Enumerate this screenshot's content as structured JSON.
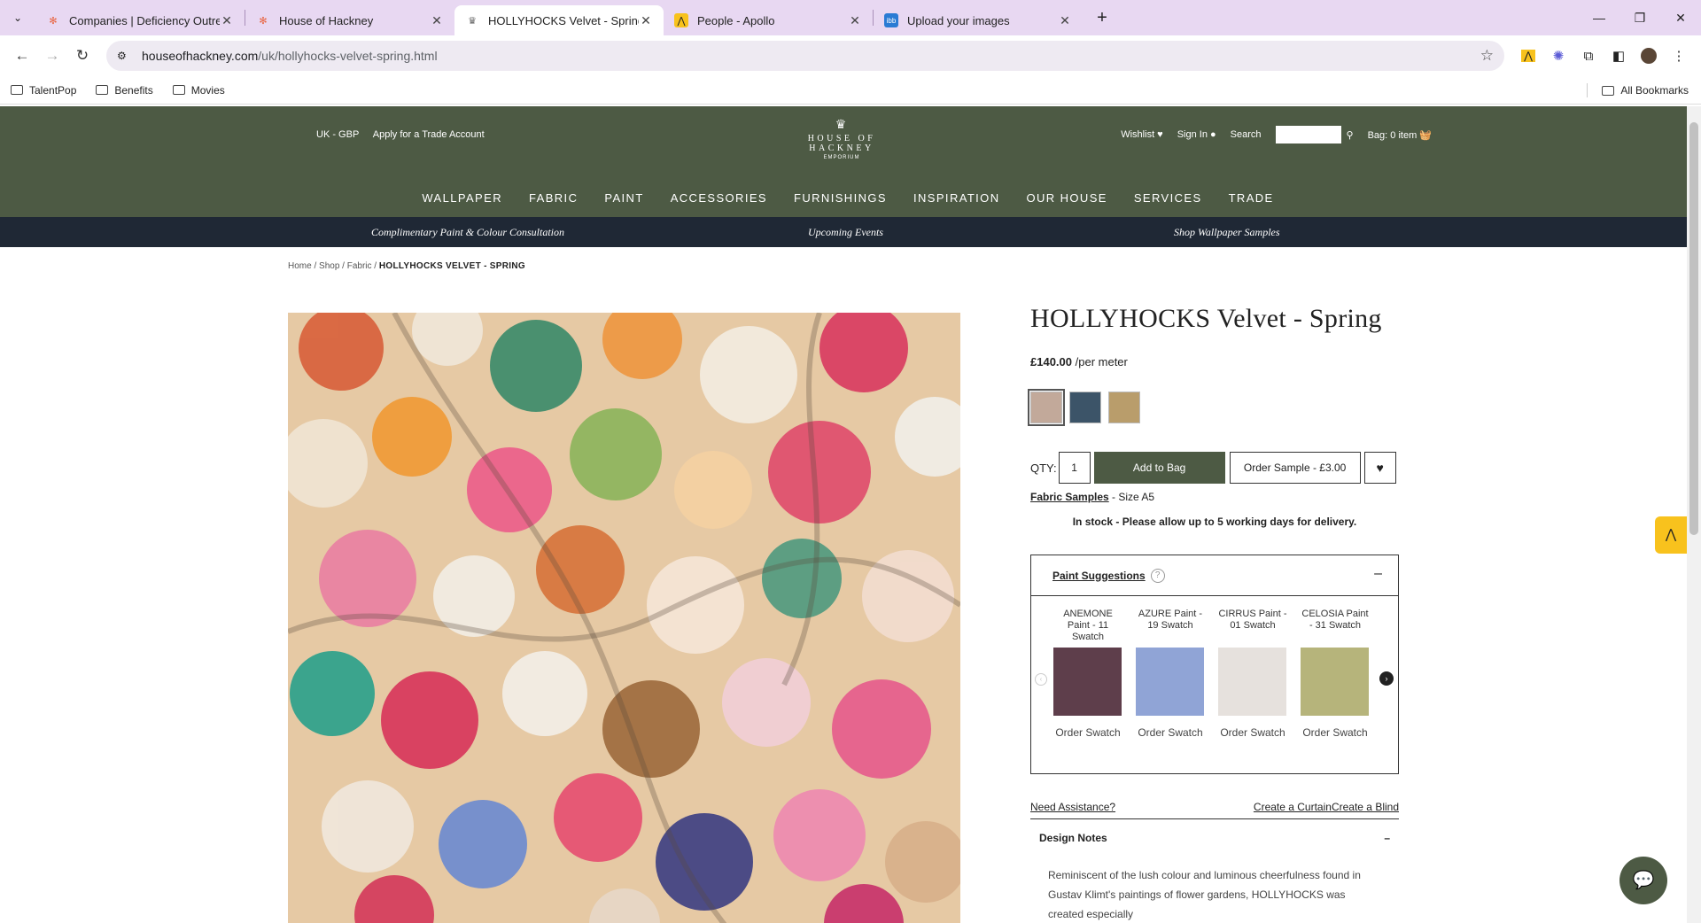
{
  "browser": {
    "tabs": [
      {
        "title": "Companies | Deficiency Outreach",
        "icon": "hubspot-icon"
      },
      {
        "title": "House of Hackney",
        "icon": "hubspot-icon"
      },
      {
        "title": "HOLLYHOCKS Velvet - Spring | House",
        "icon": "crown-icon"
      },
      {
        "title": "People - Apollo",
        "icon": "apollo-icon"
      },
      {
        "title": "Upload your images",
        "icon": "imgbb-icon"
      }
    ],
    "url_domain": "houseofhackney.com",
    "url_path": "/uk/hollyhocks-velvet-spring.html",
    "bookmarks": [
      "TalentPop",
      "Benefits",
      "Movies"
    ],
    "all_bookmarks": "All Bookmarks"
  },
  "header": {
    "region": "UK - GBP",
    "trade_account": "Apply for a Trade Account",
    "logo_name": "HOUSE OF HACKNEY",
    "logo_sub": "EMPORIUM",
    "wishlist": "Wishlist ♥",
    "signin": "Sign In ●",
    "search": "Search",
    "bag": "Bag: 0 item",
    "nav": [
      "WALLPAPER",
      "FABRIC",
      "PAINT",
      "ACCESSORIES",
      "FURNISHINGS",
      "INSPIRATION",
      "OUR HOUSE",
      "SERVICES",
      "TRADE"
    ]
  },
  "promo": {
    "left": "Complimentary Paint & Colour Consultation",
    "center": "Upcoming Events",
    "right": "Shop Wallpaper Samples"
  },
  "breadcrumb": {
    "home": "Home",
    "shop": "Shop",
    "fabric": "Fabric",
    "current": "HOLLYHOCKS VELVET - SPRING"
  },
  "product": {
    "title": "HOLLYHOCKS Velvet - Spring",
    "price": "£140.00",
    "price_unit": "/per meter",
    "qty_label": "QTY:",
    "qty": "1",
    "add_to_bag": "Add to Bag",
    "order_sample": "Order Sample - £3.00",
    "fabric_samples": "Fabric Samples",
    "sample_size": " - Size A5",
    "stock": "In stock - Please allow up to 5 working days for delivery.",
    "swatch_colors": [
      "#c2a99a",
      "#3c5468",
      "#b99d6b"
    ]
  },
  "paint_suggestions": {
    "title": "Paint Suggestions",
    "collapse": "–",
    "items": [
      {
        "name": "ANEMONE Paint - 11 Swatch",
        "color": "#5e3e4b",
        "action": "Order Swatch"
      },
      {
        "name": "AZURE Paint - 19 Swatch",
        "color": "#90a4d6",
        "action": "Order Swatch"
      },
      {
        "name": "CIRRUS Paint - 01 Swatch",
        "color": "#e6e1dd",
        "action": "Order Swatch"
      },
      {
        "name": "CELOSIA Paint - 31 Swatch",
        "color": "#b6b47b",
        "action": "Order Swatch"
      }
    ]
  },
  "links": {
    "need_assistance": "Need Assistance?",
    "create_curtain": "Create a Curtain",
    "create_blind": "Create a Blind"
  },
  "design_notes": {
    "title": "Design Notes",
    "collapse": "–",
    "text": "Reminiscent of the lush colour and luminous cheerfulness found in Gustav Klimt's paintings of flower gardens, HOLLYHOCKS was created especially"
  }
}
